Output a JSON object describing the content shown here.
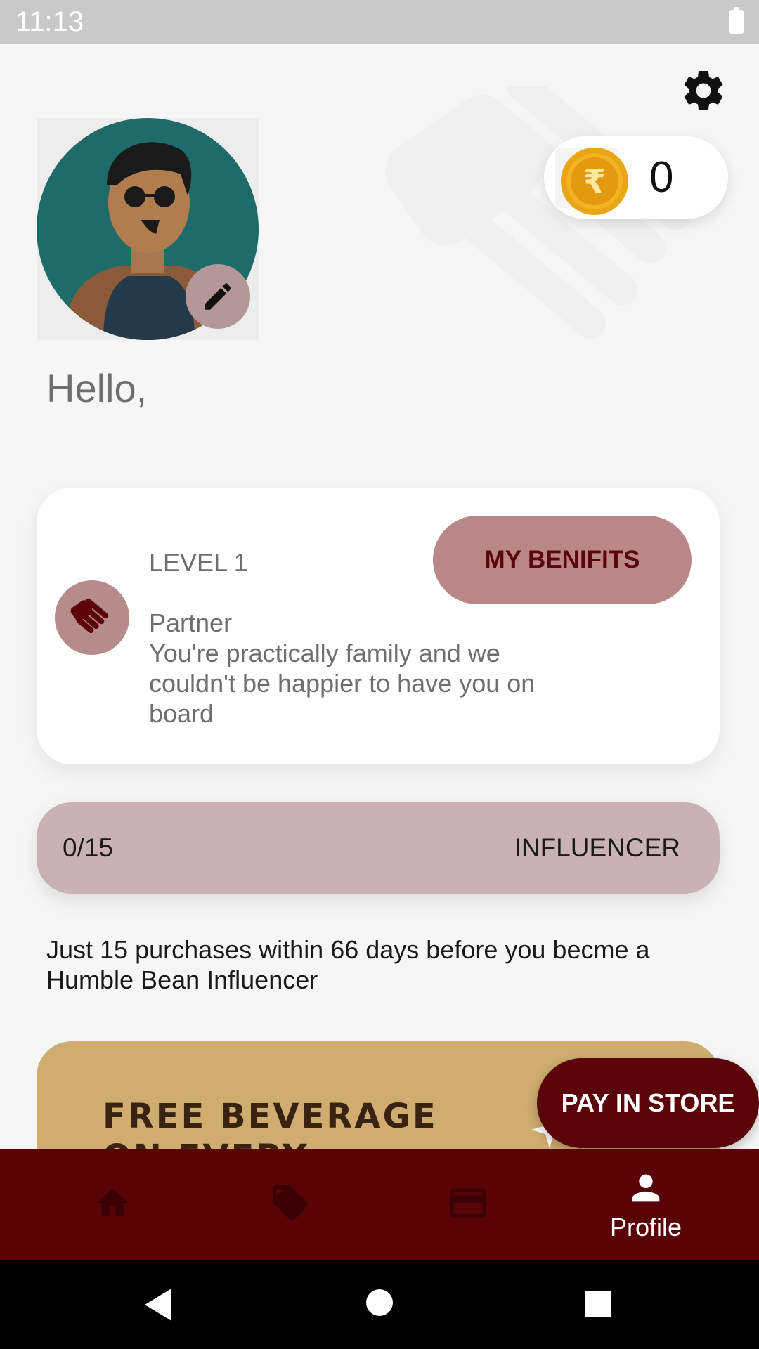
{
  "status_bar": {
    "time": "11:13"
  },
  "header": {
    "coin_count": "0",
    "greeting": "Hello,"
  },
  "level_card": {
    "level": "LEVEL 1",
    "tier_name": "Partner",
    "description": "You're practically family and we couldn't be happier to have you on board",
    "benefits_button": "MY BENIFITS"
  },
  "progress": {
    "count": "0/15",
    "target_tier": "INFLUENCER",
    "fraction": 0,
    "note": "Just 15 purchases within 66 days before you becme a Humble Bean Influencer"
  },
  "promo": {
    "text": "FREE BEVERAGE ON EVERY"
  },
  "pay_button": "PAY IN STORE",
  "bottom_nav": {
    "items": [
      {
        "icon": "home-icon",
        "label": ""
      },
      {
        "icon": "tag-icon",
        "label": ""
      },
      {
        "icon": "card-icon",
        "label": ""
      },
      {
        "icon": "person-icon",
        "label": "Profile"
      }
    ]
  },
  "colors": {
    "brand_maroon": "#5a0307",
    "benefits_button": "#b98787",
    "progress_track": "#c8b2b5",
    "promo_background": "#cfad70"
  }
}
